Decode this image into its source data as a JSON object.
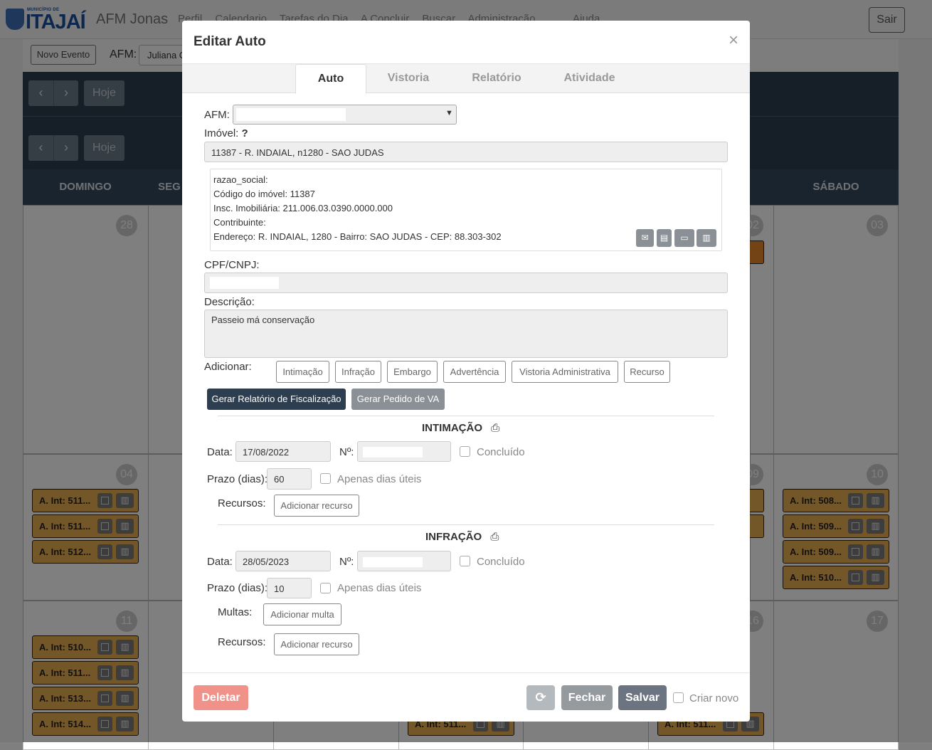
{
  "app": {
    "logo_top": "MUNICÍPIO DE",
    "logo_city": "ITAJAÍ",
    "brand": "AFM Jonas",
    "nav": [
      "Perfil",
      "Calendario",
      "Tarefas do Dia",
      "A Concluir",
      "Buscar",
      "Administração"
    ],
    "help": "Ajuda",
    "logout": "Sair",
    "new_event": "Novo Evento",
    "afm_label": "AFM:",
    "afm_value": "Juliana C",
    "today": "Hoje",
    "prev": "‹",
    "next": "›",
    "weekdays": {
      "sun": "DOMINGO",
      "mon": "SEG",
      "sat": "SÁBADO"
    },
    "days": [
      "28",
      "02",
      "03",
      "04",
      "09",
      "10",
      "11",
      "16",
      "17"
    ],
    "events": {
      "d04": [
        "A. Int: 511...",
        "A. Int: 511...",
        "A. Int: 512..."
      ],
      "d10": [
        "A. Int: 508...",
        "A. Int: 509...",
        "A. Int: 509...",
        "A. Int: 510..."
      ],
      "d11": [
        "A. Int: 510...",
        "A. Int: 511...",
        "A. Int: 513...",
        "A. Int: 514..."
      ],
      "bottom": [
        "A. Int: 511...",
        "A. Int: 511..."
      ]
    }
  },
  "modal": {
    "title": "Editar Auto",
    "close": "×",
    "tabs": [
      "Auto",
      "Vistoria",
      "Relatório",
      "Atividade"
    ],
    "afm_label": "AFM:",
    "imovel_label": "Imóvel:",
    "imovel_help": "?",
    "imovel_value": "11387 - R. INDAIAL, n1280 - SAO JUDAS",
    "info": {
      "razao": "razao_social:",
      "codigo": "Código do imóvel: 11387",
      "insc": "Insc. Imobiliária: 211.006.03.0390.0000.000",
      "contrib": "Contribuinte:",
      "endereco": "Endereço: R. INDAIAL, 1280 - Bairro: SAO JUDAS - CEP: 88.303-302"
    },
    "info_icons": [
      "envelope-icon",
      "document-icon",
      "id-card-icon",
      "map-icon"
    ],
    "cpf_label": "CPF/CNPJ:",
    "desc_label": "Descrição:",
    "desc_value": "Passeio má conservação",
    "add_label": "Adicionar:",
    "add_buttons": [
      "Intimação",
      "Infração",
      "Embargo",
      "Advertência",
      "Vistoria Administrativa",
      "Recurso"
    ],
    "gen_report": "Gerar Relatório de Fiscalização",
    "gen_va": "Gerar Pedido de VA",
    "intimacao": {
      "title": "INTIMAÇÃO",
      "date_label": "Data:",
      "date": "17/08/2022",
      "num_label": "Nº:",
      "done_label": "Concluído",
      "prazo_label": "Prazo (dias):",
      "prazo": "60",
      "uteis_label": "Apenas dias úteis",
      "recursos_label": "Recursos:",
      "add_recurso": "Adicionar recurso"
    },
    "infracao": {
      "title": "INFRAÇÃO",
      "date_label": "Data:",
      "date": "28/05/2023",
      "num_label": "Nº:",
      "done_label": "Concluído",
      "prazo_label": "Prazo (dias):",
      "prazo": "10",
      "uteis_label": "Apenas dias úteis",
      "multas_label": "Multas:",
      "add_multa": "Adicionar multa",
      "recursos_label": "Recursos:",
      "add_recurso": "Adicionar recurso"
    },
    "footer": {
      "delete": "Deletar",
      "refresh_icon": "refresh-icon",
      "close": "Fechar",
      "save": "Salvar",
      "create_new": "Criar novo"
    }
  }
}
